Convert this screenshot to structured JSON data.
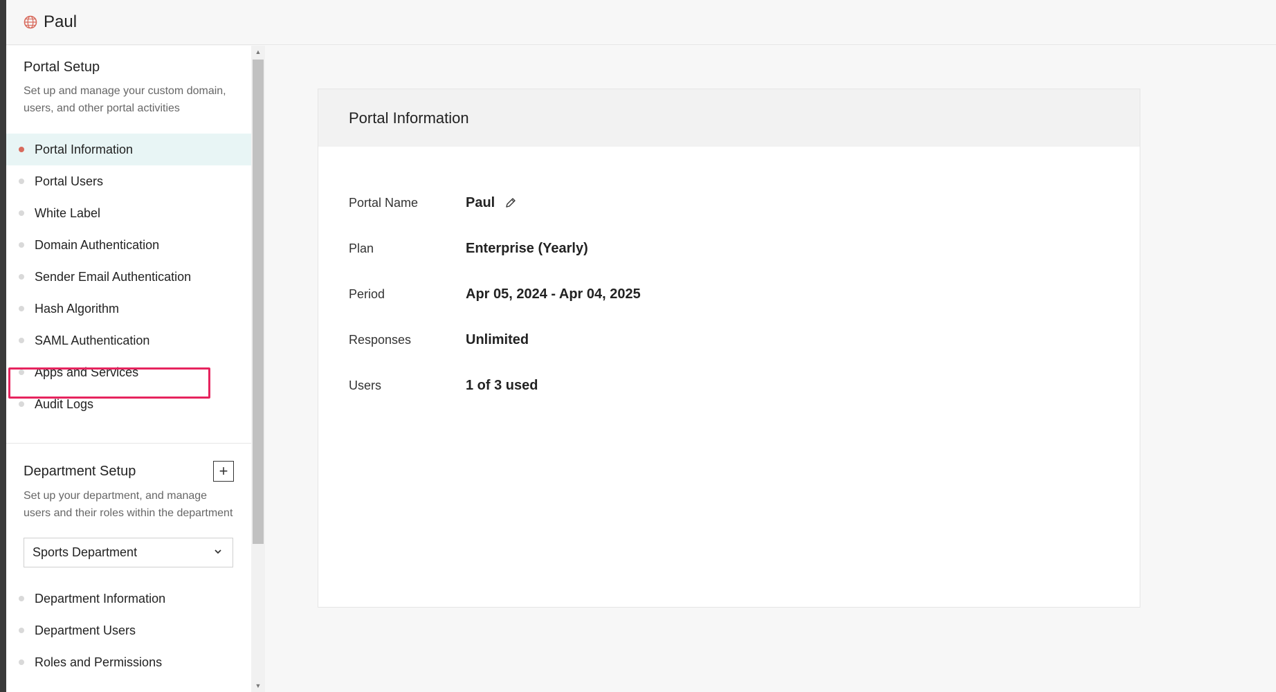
{
  "header": {
    "portal_name": "Paul",
    "logo_icon": "globe-icon"
  },
  "sidebar": {
    "portal_setup": {
      "title": "Portal Setup",
      "description": "Set up and manage your custom domain, users, and other portal activities",
      "items": [
        {
          "label": "Portal Information",
          "active": true
        },
        {
          "label": "Portal Users"
        },
        {
          "label": "White Label"
        },
        {
          "label": "Domain Authentication"
        },
        {
          "label": "Sender Email Authentication"
        },
        {
          "label": "Hash Algorithm"
        },
        {
          "label": "SAML Authentication"
        },
        {
          "label": "Apps and Services"
        },
        {
          "label": "Audit Logs"
        }
      ]
    },
    "department_setup": {
      "title": "Department Setup",
      "add_icon": "plus-icon",
      "description": "Set up your department, and manage users and their roles within the department",
      "selected_department": "Sports Department",
      "items": [
        {
          "label": "Department Information"
        },
        {
          "label": "Department Users"
        },
        {
          "label": "Roles and Permissions"
        }
      ]
    }
  },
  "main": {
    "card_title": "Portal Information",
    "rows": [
      {
        "label": "Portal Name",
        "value": "Paul"
      },
      {
        "label": "Plan",
        "value": "Enterprise (Yearly)"
      },
      {
        "label": "Period",
        "value": "Apr 05, 2024 - Apr 04, 2025"
      },
      {
        "label": "Responses",
        "value": "Unlimited"
      },
      {
        "label": "Users",
        "value": "1 of 3 used"
      }
    ]
  },
  "colors": {
    "active_dot": "#d86a5c",
    "active_bg": "#e8f5f5",
    "highlight_border": "#e6245e",
    "logo": "#d86a5c"
  }
}
